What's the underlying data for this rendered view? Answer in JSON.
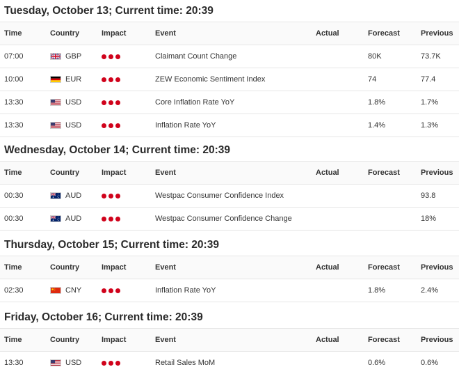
{
  "columns": {
    "time": "Time",
    "country": "Country",
    "impact": "Impact",
    "event": "Event",
    "actual": "Actual",
    "forecast": "Forecast",
    "previous": "Previous"
  },
  "impact_color": "#d0021b",
  "days": [
    {
      "heading": "Tuesday, October 13; Current time: 20:39",
      "events": [
        {
          "time": "07:00",
          "flag_icon": "uk-flag-icon",
          "country": "GBP",
          "impact": "high",
          "event": "Claimant Count Change",
          "actual": "",
          "forecast": "80K",
          "previous": "73.7K"
        },
        {
          "time": "10:00",
          "flag_icon": "germany-flag-icon",
          "country": "EUR",
          "impact": "high",
          "event": "ZEW Economic Sentiment Index",
          "actual": "",
          "forecast": "74",
          "previous": "77.4"
        },
        {
          "time": "13:30",
          "flag_icon": "us-flag-icon",
          "country": "USD",
          "impact": "high",
          "event": "Core Inflation Rate YoY",
          "actual": "",
          "forecast": "1.8%",
          "previous": "1.7%"
        },
        {
          "time": "13:30",
          "flag_icon": "us-flag-icon",
          "country": "USD",
          "impact": "high",
          "event": "Inflation Rate YoY",
          "actual": "",
          "forecast": "1.4%",
          "previous": "1.3%"
        }
      ]
    },
    {
      "heading": "Wednesday, October 14; Current time: 20:39",
      "events": [
        {
          "time": "00:30",
          "flag_icon": "australia-flag-icon",
          "country": "AUD",
          "impact": "high",
          "event": "Westpac Consumer Confidence Index",
          "actual": "",
          "forecast": "",
          "previous": "93.8"
        },
        {
          "time": "00:30",
          "flag_icon": "australia-flag-icon",
          "country": "AUD",
          "impact": "high",
          "event": "Westpac Consumer Confidence Change",
          "actual": "",
          "forecast": "",
          "previous": "18%"
        }
      ]
    },
    {
      "heading": "Thursday, October 15; Current time: 20:39",
      "events": [
        {
          "time": "02:30",
          "flag_icon": "china-flag-icon",
          "country": "CNY",
          "impact": "high",
          "event": "Inflation Rate YoY",
          "actual": "",
          "forecast": "1.8%",
          "previous": "2.4%"
        }
      ]
    },
    {
      "heading": "Friday, October 16; Current time: 20:39",
      "events": [
        {
          "time": "13:30",
          "flag_icon": "us-flag-icon",
          "country": "USD",
          "impact": "high",
          "event": "Retail Sales MoM",
          "actual": "",
          "forecast": "0.6%",
          "previous": "0.6%"
        }
      ]
    }
  ]
}
